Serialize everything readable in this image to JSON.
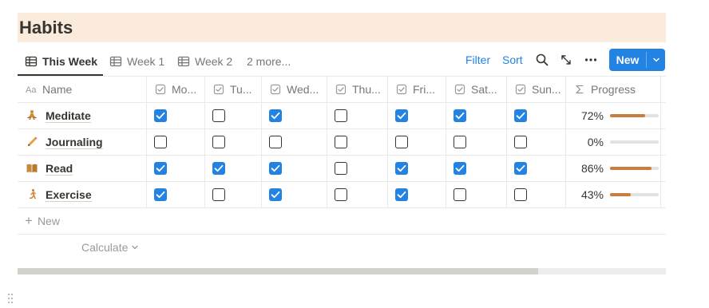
{
  "page": {
    "title": "Habits"
  },
  "views": {
    "tabs": [
      {
        "label": "This Week",
        "icon": "table-icon",
        "active": true
      },
      {
        "label": "Week 1",
        "icon": "table-icon",
        "active": false
      },
      {
        "label": "Week 2",
        "icon": "table-icon",
        "active": false
      },
      {
        "label": "2 more...",
        "icon": "",
        "active": false
      }
    ],
    "filter_label": "Filter",
    "sort_label": "Sort",
    "new_label": "New"
  },
  "table": {
    "columns": [
      {
        "label": "Name",
        "icon": "Aa"
      },
      {
        "label": "Mo...",
        "icon": "checkbox-property-icon"
      },
      {
        "label": "Tu...",
        "icon": "checkbox-property-icon"
      },
      {
        "label": "Wed...",
        "icon": "checkbox-property-icon"
      },
      {
        "label": "Thu...",
        "icon": "checkbox-property-icon"
      },
      {
        "label": "Fri...",
        "icon": "checkbox-property-icon"
      },
      {
        "label": "Sat...",
        "icon": "checkbox-property-icon"
      },
      {
        "label": "Sun...",
        "icon": "checkbox-property-icon"
      },
      {
        "label": "Progress",
        "icon": "sigma-formula-icon"
      }
    ],
    "rows": [
      {
        "name": "Meditate",
        "emoji": "meditation-icon",
        "days": [
          true,
          false,
          true,
          false,
          true,
          true,
          true
        ],
        "progress_label": "72%",
        "progress": 0.72
      },
      {
        "name": "Journaling",
        "emoji": "pencil-icon",
        "days": [
          false,
          false,
          false,
          false,
          false,
          false,
          false
        ],
        "progress_label": "0%",
        "progress": 0.0
      },
      {
        "name": "Read",
        "emoji": "book-icon",
        "days": [
          true,
          true,
          true,
          false,
          true,
          true,
          true
        ],
        "progress_label": "86%",
        "progress": 0.86
      },
      {
        "name": "Exercise",
        "emoji": "running-icon",
        "days": [
          true,
          false,
          true,
          false,
          true,
          false,
          false
        ],
        "progress_label": "43%",
        "progress": 0.43
      }
    ],
    "new_row_label": "New",
    "calculate_label": "Calculate"
  },
  "colors": {
    "accent": "#2383e2",
    "title_background": "#faebdd",
    "progress_fill": "#c87d3c",
    "progress_track": "#e3e2e0"
  }
}
